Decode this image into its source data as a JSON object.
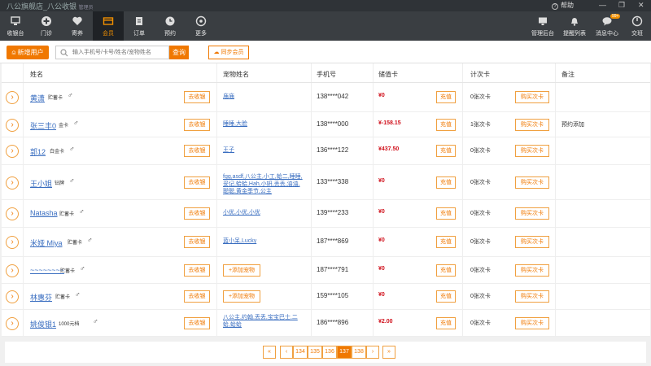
{
  "window": {
    "title": "八公旗舰店_八公收银",
    "subtitle": "管理员",
    "help": "帮助"
  },
  "nav": {
    "items": [
      {
        "label": "收银台"
      },
      {
        "label": "门诊"
      },
      {
        "label": "寄养"
      },
      {
        "label": "会员"
      },
      {
        "label": "订单"
      },
      {
        "label": "预约"
      },
      {
        "label": "更多"
      }
    ],
    "right": [
      {
        "label": "管理后台"
      },
      {
        "label": "提醒列表"
      },
      {
        "label": "消息中心",
        "badge": "99+"
      },
      {
        "label": "交班"
      }
    ],
    "active_index": 3,
    "accent": "#f29000"
  },
  "toolbar": {
    "new_user": "新增用户",
    "search_placeholder": "输入手机号/卡号/姓名/宠物姓名",
    "search_btn": "查询",
    "sync": "同步会员"
  },
  "table": {
    "headers": [
      "姓名",
      "宠物姓名",
      "手机号",
      "储值卡",
      "计次卡",
      "备注"
    ],
    "cashier_label": "去收银",
    "recharge_label": "充值",
    "buy_label": "购买次卡",
    "add_pet_label": "+添加宠物",
    "rows": [
      {
        "name": "黄潇",
        "level": "贮蓄卡",
        "pets": "庙庙",
        "phone": "138****042",
        "stored": "¥0",
        "count": "0张次卡",
        "remark": ""
      },
      {
        "name": "张三丰0",
        "level": "金卡",
        "pets": "睡睡,大脸",
        "phone": "138****000",
        "stored": "¥-158.15",
        "count": "1张次卡",
        "remark": "预约添加"
      },
      {
        "name": "郭12",
        "level": "白金卡",
        "pets": "王子",
        "phone": "136****122",
        "stored": "¥437.50",
        "count": "0张次卡",
        "remark": ""
      },
      {
        "name": "王小姐",
        "level": "钻牌",
        "pets": "fgg,asdf,八公主,小工,蛤二,睡睡,妥记,蛤蛤,Hah,小妍,丢丢,油油,聪聪,黄金季节,公主",
        "phone": "133****338",
        "stored": "¥0",
        "count": "0张次卡",
        "remark": ""
      },
      {
        "name": "Natasha",
        "level": "贮蓄卡",
        "pets": "小优,小优,小优",
        "phone": "139****233",
        "stored": "¥0",
        "count": "0张次卡",
        "remark": ""
      },
      {
        "name": "米娅 Miya",
        "level": "贮蓄卡",
        "pets": "蓝小呆,Lucky",
        "phone": "187****869",
        "stored": "¥0",
        "count": "0张次卡",
        "remark": ""
      },
      {
        "name": "~~~~~~~~",
        "level": "贮蓄卡",
        "pets": "",
        "phone": "187****791",
        "stored": "¥0",
        "count": "0张次卡",
        "remark": ""
      },
      {
        "name": "林惠芬",
        "level": "贮蓄卡",
        "pets": "",
        "phone": "159****105",
        "stored": "¥0",
        "count": "0张次卡",
        "remark": ""
      },
      {
        "name": "姚俊银1",
        "level": "1000元档",
        "pets": "八公主,约翰,丢丢,宝宝巴士,二蛤,蛤蛤",
        "phone": "186****896",
        "stored": "¥2.00",
        "count": "0张次卡",
        "remark": ""
      }
    ]
  },
  "pager": {
    "first": "«",
    "prev": "‹",
    "pages": [
      "134",
      "135",
      "136",
      "137",
      "138"
    ],
    "current": "137",
    "next": "›",
    "last": "»"
  }
}
